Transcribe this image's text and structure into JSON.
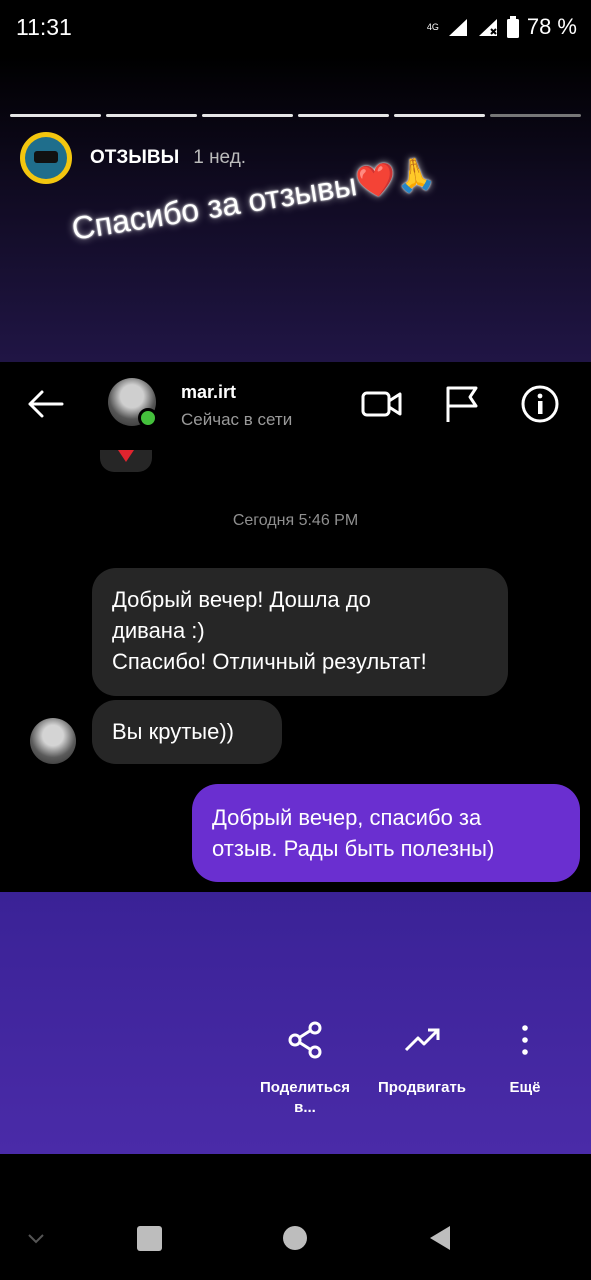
{
  "status_bar": {
    "time": "11:31",
    "network": "4G",
    "battery": "78 %"
  },
  "story": {
    "account_name": "ОТЗЫВЫ",
    "posted_ago": "1 нед.",
    "caption": "Спасибо за отзывы❤️🙏",
    "progress_segments": 6
  },
  "chat": {
    "username": "mar.irt",
    "status": "Сейчас в сети",
    "timestamp": "Сегодня 5:46 PM",
    "messages": [
      {
        "direction": "incoming",
        "text_lines": [
          "Добрый вечер! Дошла до",
          "дивана :)",
          "Спасибо! Отличный результат!"
        ]
      },
      {
        "direction": "incoming",
        "text": "Вы крутые))"
      },
      {
        "direction": "outgoing",
        "text_lines": [
          "Добрый вечер, спасибо за",
          "отзыв. Рады быть полезны)"
        ]
      }
    ],
    "icons": [
      "back-arrow-icon",
      "video-call-icon",
      "flag-icon",
      "info-icon"
    ]
  },
  "actions": [
    {
      "id": "share",
      "icon": "share-icon",
      "label_lines": [
        "Поделиться",
        "в..."
      ]
    },
    {
      "id": "promote",
      "icon": "trending-up-icon",
      "label": "Продвигать"
    },
    {
      "id": "more",
      "icon": "more-vertical-icon",
      "label": "Ещё"
    }
  ],
  "colors": {
    "outgoing_bubble": "#6a2fd0",
    "incoming_bubble": "#262626",
    "online": "#44c03c",
    "story_bottom": "#4a2ba8"
  }
}
